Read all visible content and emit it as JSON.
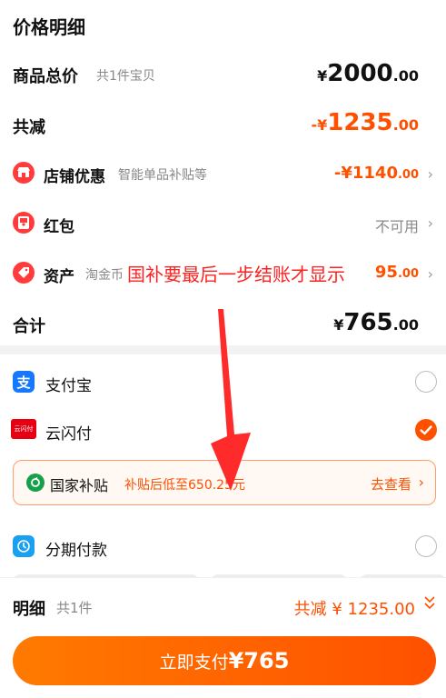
{
  "price_detail": {
    "title": "价格明细",
    "total": {
      "label": "商品总价",
      "sub": "共1件宝贝",
      "yen": "¥",
      "amount": "2000",
      "decimal": ".00"
    },
    "discount": {
      "label": "共减",
      "prefix": "-¥",
      "amount": "1235",
      "decimal": ".00"
    },
    "shop": {
      "label": "店铺优惠",
      "sub": "智能单品补贴等",
      "value": "-¥1140",
      "decimal": ".00"
    },
    "redpacket": {
      "label": "红包",
      "value": "不可用"
    },
    "asset": {
      "label": "资产",
      "sub": "淘金币",
      "value": "95",
      "decimal": ".00"
    },
    "sum": {
      "label": "合计",
      "yen": "¥",
      "amount": "765",
      "decimal": ".00"
    }
  },
  "payment": {
    "alipay": {
      "label": "支付宝",
      "selected": false
    },
    "unionpay": {
      "label": "云闪付",
      "selected": true,
      "logo_text": "云闪付"
    },
    "subsidy": {
      "label": "国家补贴",
      "desc": "补贴后低至650.25元",
      "action": "去查看"
    },
    "installment": {
      "label": "分期付款",
      "selected": false
    }
  },
  "bottom": {
    "detail_label": "明细",
    "count": "共1件",
    "discount": "共减 ¥ 1235.00",
    "pay_prefix": "立即支付",
    "pay_amount": "¥765"
  },
  "annotation": {
    "text": "国补要最后一步结账才显示"
  },
  "colors": {
    "accent": "#ff5000",
    "annotation": "#ff2020",
    "alipay": "#1677ff",
    "green": "#16a04a"
  }
}
